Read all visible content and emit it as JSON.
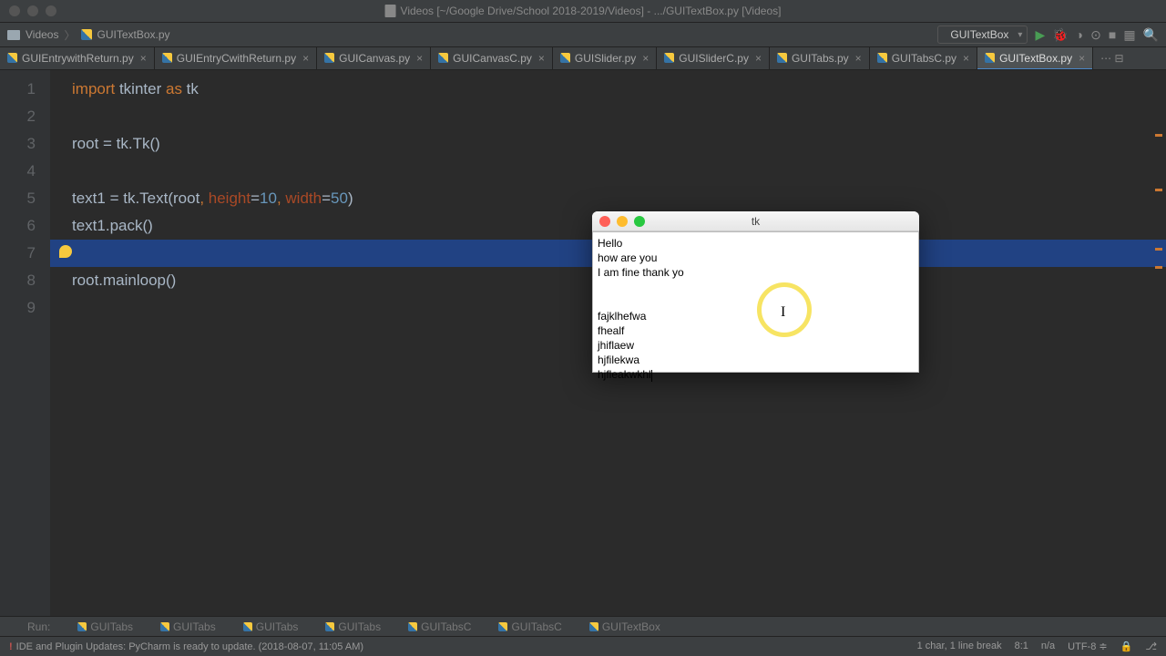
{
  "window": {
    "title": "Videos [~/Google Drive/School 2018-2019/Videos] - .../GUITextBox.py [Videos]"
  },
  "breadcrumb": {
    "folder": "Videos",
    "file": "GUITextBox.py"
  },
  "run_config": "GUITextBox",
  "tabs": [
    {
      "label": "GUIEntrywithReturn.py",
      "active": false
    },
    {
      "label": "GUIEntryCwithReturn.py",
      "active": false
    },
    {
      "label": "GUICanvas.py",
      "active": false
    },
    {
      "label": "GUICanvasC.py",
      "active": false
    },
    {
      "label": "GUISlider.py",
      "active": false
    },
    {
      "label": "GUISliderC.py",
      "active": false
    },
    {
      "label": "GUITabs.py",
      "active": false
    },
    {
      "label": "GUITabsC.py",
      "active": false
    },
    {
      "label": "GUITextBox.py",
      "active": true
    }
  ],
  "code": {
    "lines": [
      "1",
      "2",
      "3",
      "4",
      "5",
      "6",
      "7",
      "8",
      "9"
    ],
    "l1a": "import",
    "l1b": " tkinter ",
    "l1c": "as",
    "l1d": " tk",
    "l3": "root = tk.Tk()",
    "l5a": "text1 = tk.Text(root",
    "l5b": ", ",
    "l5c": "height",
    "l5d": "=",
    "l5e": "10",
    "l5f": ", ",
    "l5g": "width",
    "l5h": "=",
    "l5i": "50",
    "l5j": ")",
    "l6": "text1.pack()",
    "l8": "root.mainloop()"
  },
  "tk_window": {
    "title": "tk",
    "text": "Hello\nhow are you\nI am fine thank yo\n\n\nfajklhefwa\nfhealf\njhiflaew\nhjfilekwa\nhjfleakwkhl"
  },
  "status": {
    "left": "IDE and Plugin Updates: PyCharm is ready to update. (2018-08-07, 11:05 AM)",
    "chars": "1 char, 1 line break",
    "pos": "8:1",
    "ins": "n/a",
    "enc": "UTF-8 ≑",
    "lock": "🔒",
    "git": "⎇"
  },
  "bottom_tabs": [
    "Run:",
    "GUITabs",
    "GUITabs",
    "GUITabs",
    "GUITabs",
    "GUITabsC",
    "GUITabsC",
    "GUITextBox"
  ]
}
